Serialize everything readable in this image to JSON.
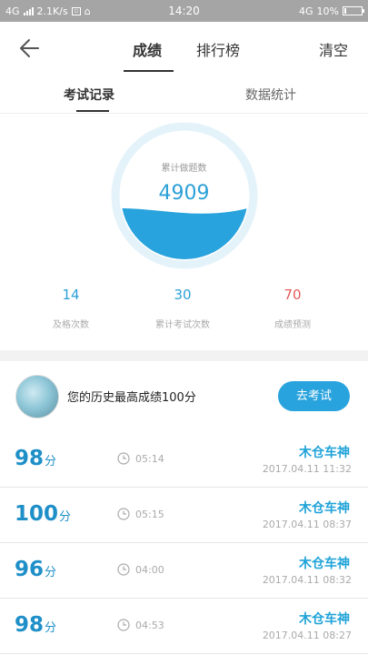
{
  "status_bar": {
    "network_left": "4G",
    "speed": "2.1K/s",
    "time": "14:20",
    "network_right": "4G",
    "battery": "10%"
  },
  "header": {
    "back_icon": "arrow-left-icon",
    "tabs": [
      "成绩",
      "排行榜"
    ],
    "active_tab": 0,
    "right_action": "清空"
  },
  "subtabs": {
    "items": [
      "考试记录",
      "数据统计"
    ],
    "active": 0
  },
  "summary": {
    "gauge_label": "累计做题数",
    "gauge_value": "4909",
    "gauge_fill_fraction": 0.4,
    "stats": [
      {
        "value": "14",
        "label": "及格次数",
        "color": "#2ca0d8"
      },
      {
        "value": "30",
        "label": "累计考试次数",
        "color": "#2ca0d8"
      },
      {
        "value": "70",
        "label": "成绩预测",
        "color": "#e45a5a"
      }
    ]
  },
  "best": {
    "text": "您的历史最高成绩100分",
    "button": "去考试"
  },
  "records": [
    {
      "score": "98",
      "unit": "分",
      "duration": "05:14",
      "name": "木仓车神",
      "date": "2017.04.11  11:32"
    },
    {
      "score": "100",
      "unit": "分",
      "duration": "05:15",
      "name": "木仓车神",
      "date": "2017.04.11  08:37"
    },
    {
      "score": "96",
      "unit": "分",
      "duration": "04:00",
      "name": "木仓车神",
      "date": "2017.04.11  08:32"
    },
    {
      "score": "98",
      "unit": "分",
      "duration": "04:53",
      "name": "木仓车神",
      "date": "2017.04.11  08:27"
    }
  ],
  "colors": {
    "accent": "#29a3dd",
    "status_bar": "#a5a5a5",
    "prediction": "#e45a5a"
  }
}
